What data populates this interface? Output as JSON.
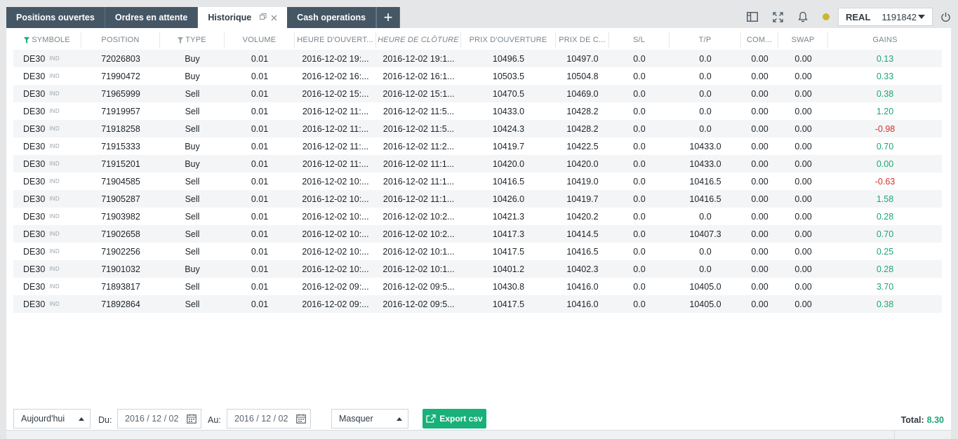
{
  "tabs": [
    {
      "label": "Positions ouvertes"
    },
    {
      "label": "Ordres en attente"
    },
    {
      "label": "Historique",
      "active": true
    },
    {
      "label": "Cash operations"
    }
  ],
  "tab_add_label": "+",
  "account": {
    "type": "REAL",
    "number": "1191842"
  },
  "columns": [
    "SYMBOLE",
    "POSITION",
    "TYPE",
    "VOLUME",
    "HEURE D'OUVERT...",
    "HEURE DE CLÔTURE",
    "PRIX D'OUVERTURE",
    "PRIX DE C...",
    "S/L",
    "T/P",
    "COM...",
    "SWAP",
    "GAINS"
  ],
  "rows": [
    {
      "symbol": "DE30",
      "badge": "IND",
      "position": "72026803",
      "type": "Buy",
      "volume": "0.01",
      "open_time": "2016-12-02 19:...",
      "close_time": "2016-12-02 19:1...",
      "open_price": "10496.5",
      "close_price": "10497.0",
      "sl": "0.0",
      "tp": "0.0",
      "commission": "0.00",
      "swap": "0.00",
      "gain": "0.13"
    },
    {
      "symbol": "DE30",
      "badge": "IND",
      "position": "71990472",
      "type": "Buy",
      "volume": "0.01",
      "open_time": "2016-12-02 16:...",
      "close_time": "2016-12-02 16:1...",
      "open_price": "10503.5",
      "close_price": "10504.8",
      "sl": "0.0",
      "tp": "0.0",
      "commission": "0.00",
      "swap": "0.00",
      "gain": "0.33"
    },
    {
      "symbol": "DE30",
      "badge": "IND",
      "position": "71965999",
      "type": "Sell",
      "volume": "0.01",
      "open_time": "2016-12-02 15:...",
      "close_time": "2016-12-02 15:1...",
      "open_price": "10470.5",
      "close_price": "10469.0",
      "sl": "0.0",
      "tp": "0.0",
      "commission": "0.00",
      "swap": "0.00",
      "gain": "0.38"
    },
    {
      "symbol": "DE30",
      "badge": "IND",
      "position": "71919957",
      "type": "Sell",
      "volume": "0.01",
      "open_time": "2016-12-02 11:...",
      "close_time": "2016-12-02 11:5...",
      "open_price": "10433.0",
      "close_price": "10428.2",
      "sl": "0.0",
      "tp": "0.0",
      "commission": "0.00",
      "swap": "0.00",
      "gain": "1.20"
    },
    {
      "symbol": "DE30",
      "badge": "IND",
      "position": "71918258",
      "type": "Sell",
      "volume": "0.01",
      "open_time": "2016-12-02 11:...",
      "close_time": "2016-12-02 11:5...",
      "open_price": "10424.3",
      "close_price": "10428.2",
      "sl": "0.0",
      "tp": "0.0",
      "commission": "0.00",
      "swap": "0.00",
      "gain": "-0.98"
    },
    {
      "symbol": "DE30",
      "badge": "IND",
      "position": "71915333",
      "type": "Buy",
      "volume": "0.01",
      "open_time": "2016-12-02 11:...",
      "close_time": "2016-12-02 11:2...",
      "open_price": "10419.7",
      "close_price": "10422.5",
      "sl": "0.0",
      "tp": "10433.0",
      "commission": "0.00",
      "swap": "0.00",
      "gain": "0.70"
    },
    {
      "symbol": "DE30",
      "badge": "IND",
      "position": "71915201",
      "type": "Buy",
      "volume": "0.01",
      "open_time": "2016-12-02 11:...",
      "close_time": "2016-12-02 11:1...",
      "open_price": "10420.0",
      "close_price": "10420.0",
      "sl": "0.0",
      "tp": "10433.0",
      "commission": "0.00",
      "swap": "0.00",
      "gain": "0.00"
    },
    {
      "symbol": "DE30",
      "badge": "IND",
      "position": "71904585",
      "type": "Sell",
      "volume": "0.01",
      "open_time": "2016-12-02 10:...",
      "close_time": "2016-12-02 11:1...",
      "open_price": "10416.5",
      "close_price": "10419.0",
      "sl": "0.0",
      "tp": "10416.5",
      "commission": "0.00",
      "swap": "0.00",
      "gain": "-0.63"
    },
    {
      "symbol": "DE30",
      "badge": "IND",
      "position": "71905287",
      "type": "Sell",
      "volume": "0.01",
      "open_time": "2016-12-02 10:...",
      "close_time": "2016-12-02 11:1...",
      "open_price": "10426.0",
      "close_price": "10419.7",
      "sl": "0.0",
      "tp": "10416.5",
      "commission": "0.00",
      "swap": "0.00",
      "gain": "1.58"
    },
    {
      "symbol": "DE30",
      "badge": "IND",
      "position": "71903982",
      "type": "Sell",
      "volume": "0.01",
      "open_time": "2016-12-02 10:...",
      "close_time": "2016-12-02 10:2...",
      "open_price": "10421.3",
      "close_price": "10420.2",
      "sl": "0.0",
      "tp": "0.0",
      "commission": "0.00",
      "swap": "0.00",
      "gain": "0.28"
    },
    {
      "symbol": "DE30",
      "badge": "IND",
      "position": "71902658",
      "type": "Sell",
      "volume": "0.01",
      "open_time": "2016-12-02 10:...",
      "close_time": "2016-12-02 10:2...",
      "open_price": "10417.3",
      "close_price": "10414.5",
      "sl": "0.0",
      "tp": "10407.3",
      "commission": "0.00",
      "swap": "0.00",
      "gain": "0.70"
    },
    {
      "symbol": "DE30",
      "badge": "IND",
      "position": "71902256",
      "type": "Sell",
      "volume": "0.01",
      "open_time": "2016-12-02 10:...",
      "close_time": "2016-12-02 10:1...",
      "open_price": "10417.5",
      "close_price": "10416.5",
      "sl": "0.0",
      "tp": "0.0",
      "commission": "0.00",
      "swap": "0.00",
      "gain": "0.25"
    },
    {
      "symbol": "DE30",
      "badge": "IND",
      "position": "71901032",
      "type": "Buy",
      "volume": "0.01",
      "open_time": "2016-12-02 10:...",
      "close_time": "2016-12-02 10:1...",
      "open_price": "10401.2",
      "close_price": "10402.3",
      "sl": "0.0",
      "tp": "0.0",
      "commission": "0.00",
      "swap": "0.00",
      "gain": "0.28"
    },
    {
      "symbol": "DE30",
      "badge": "IND",
      "position": "71893817",
      "type": "Sell",
      "volume": "0.01",
      "open_time": "2016-12-02 09:...",
      "close_time": "2016-12-02 09:5...",
      "open_price": "10430.8",
      "close_price": "10416.0",
      "sl": "0.0",
      "tp": "10405.0",
      "commission": "0.00",
      "swap": "0.00",
      "gain": "3.70"
    },
    {
      "symbol": "DE30",
      "badge": "IND",
      "position": "71892864",
      "type": "Sell",
      "volume": "0.01",
      "open_time": "2016-12-02 09:...",
      "close_time": "2016-12-02 09:5...",
      "open_price": "10417.5",
      "close_price": "10416.0",
      "sl": "0.0",
      "tp": "10405.0",
      "commission": "0.00",
      "swap": "0.00",
      "gain": "0.38"
    }
  ],
  "footer": {
    "period": "Aujourd'hui",
    "from_label": "Du:",
    "from_date": "2016 / 12 / 02",
    "to_label": "Au:",
    "to_date": "2016 / 12 / 02",
    "mask": "Masquer",
    "export_label": "Export csv",
    "total_label": "Total:",
    "total_value": "8.30"
  },
  "colors": {
    "accent": "#18b17a",
    "positive": "#1da676",
    "negative": "#d0312d",
    "tab_bg": "#455765",
    "status_dot": "#c9b634"
  }
}
